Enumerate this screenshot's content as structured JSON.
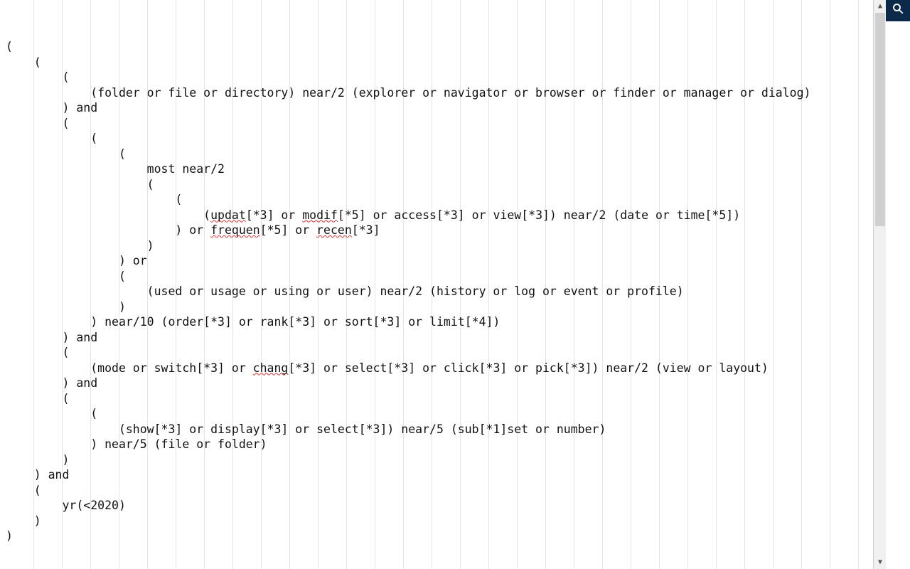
{
  "query": {
    "lines": [
      "(",
      "    (",
      "        (",
      "            (folder or file or directory) near/2 (explorer or navigator or browser or finder or manager or dialog)",
      "        ) and",
      "        (",
      "            (",
      "                (",
      "                    most near/2",
      "                    (",
      "                        (",
      "                            (updat[*3] or modif[*5] or access[*3] or view[*3]) near/2 (date or time[*5])",
      "                        ) or frequen[*5] or recen[*3]",
      "                    )",
      "                ) or",
      "                (",
      "                    (used or usage or using or user) near/2 (history or log or event or profile)",
      "                )",
      "            ) near/10 (order[*3] or rank[*3] or sort[*3] or limit[*4])",
      "        ) and",
      "        (",
      "            (mode or switch[*3] or chang[*3] or select[*3] or click[*3] or pick[*3]) near/2 (view or layout)",
      "        ) and",
      "        (",
      "            (",
      "                (show[*3] or display[*3] or select[*3]) near/5 (sub[*1]set or number)",
      "            ) near/5 (file or folder)",
      "        )",
      "    ) and",
      "    (",
      "        yr(<2020)",
      "    )",
      ")"
    ],
    "misspelled_tokens": [
      "updat",
      "modif",
      "frequen",
      "recen",
      "chang"
    ]
  },
  "ui": {
    "search_button_title": "Search",
    "scrollbar_title": "Vertical scrollbar"
  },
  "colors": {
    "search_button_bg": "#0b2a4a",
    "guide_line": "#e3e3e3",
    "squiggle": "#d33"
  }
}
